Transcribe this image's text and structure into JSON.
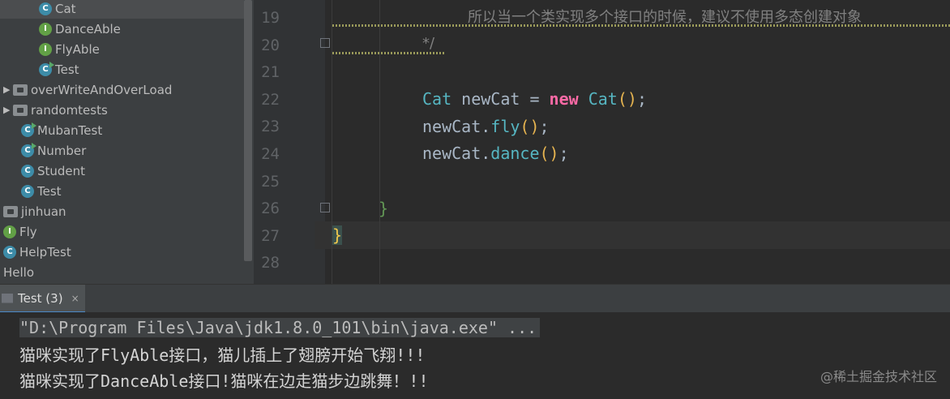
{
  "tree": {
    "items": [
      {
        "label": "Cat",
        "icon": "class-icon",
        "kind": "c",
        "indent": 2,
        "selected": true
      },
      {
        "label": "DanceAble",
        "icon": "interface-icon",
        "kind": "i",
        "indent": 2
      },
      {
        "label": "FlyAble",
        "icon": "interface-icon",
        "kind": "i",
        "indent": 2
      },
      {
        "label": "Test",
        "icon": "runnable-class-icon",
        "kind": "c",
        "run": true,
        "indent": 2
      },
      {
        "label": "overWriteAndOverLoad",
        "icon": "package-folder-icon",
        "kind": "f",
        "indent": 1,
        "arrow": true
      },
      {
        "label": "randomtests",
        "icon": "package-folder-icon",
        "kind": "f",
        "indent": 1,
        "arrow": true
      },
      {
        "label": "MubanTest",
        "icon": "runnable-class-icon",
        "kind": "c",
        "run": true,
        "indent": 1
      },
      {
        "label": "Number",
        "icon": "runnable-class-icon",
        "kind": "c",
        "run": true,
        "indent": 1
      },
      {
        "label": "Student",
        "icon": "class-icon",
        "kind": "c",
        "indent": 1
      },
      {
        "label": "Test",
        "icon": "class-icon",
        "kind": "c",
        "indent": 1
      },
      {
        "label": "jinhuan",
        "icon": "package-folder-icon",
        "kind": "f",
        "indent": 0
      },
      {
        "label": "Fly",
        "icon": "interface-icon",
        "kind": "i",
        "indent": 0
      },
      {
        "label": "HelpTest",
        "icon": "class-icon",
        "kind": "c",
        "indent": 0
      },
      {
        "label": "Hello",
        "icon": "",
        "kind": "none",
        "indent": 0
      }
    ]
  },
  "editor": {
    "line_numbers": [
      "19",
      "20",
      "21",
      "22",
      "23",
      "24",
      "25",
      "26",
      "27",
      "28"
    ],
    "line19_comment": "所以当一个类实现多个接口的时候，建议不使用多态创建对象",
    "line20_comment": "*/",
    "line22": {
      "type": "Cat",
      "var": " newCat = ",
      "kw": "new",
      "ctor": " Cat",
      "paren": "()",
      "end": ";"
    },
    "line23": {
      "obj": "newCat.",
      "method": "fly",
      "paren": "()",
      "end": ";"
    },
    "line24": {
      "obj": "newCat.",
      "method": "dance",
      "paren": "()",
      "end": ";"
    },
    "line26_brace": "}",
    "line27_brace": "}"
  },
  "run": {
    "tab_label": "Test (3)",
    "tab_close": "×",
    "command": "\"D:\\Program Files\\Java\\jdk1.8.0_101\\bin\\java.exe\" ...",
    "out1_a": "猫咪实现了",
    "out1_b": "FlyAble",
    "out1_c": "接口，猫儿插上了翅膀开始飞翔",
    "out1_d": "!!!",
    "out2_a": "猫咪实现了",
    "out2_b": "DanceAble",
    "out2_c": "接口",
    "out2_d": "!",
    "out2_e": "猫咪在边走猫步边跳舞！",
    "out2_f": "!!"
  },
  "watermark": "@稀土掘金技术社区"
}
